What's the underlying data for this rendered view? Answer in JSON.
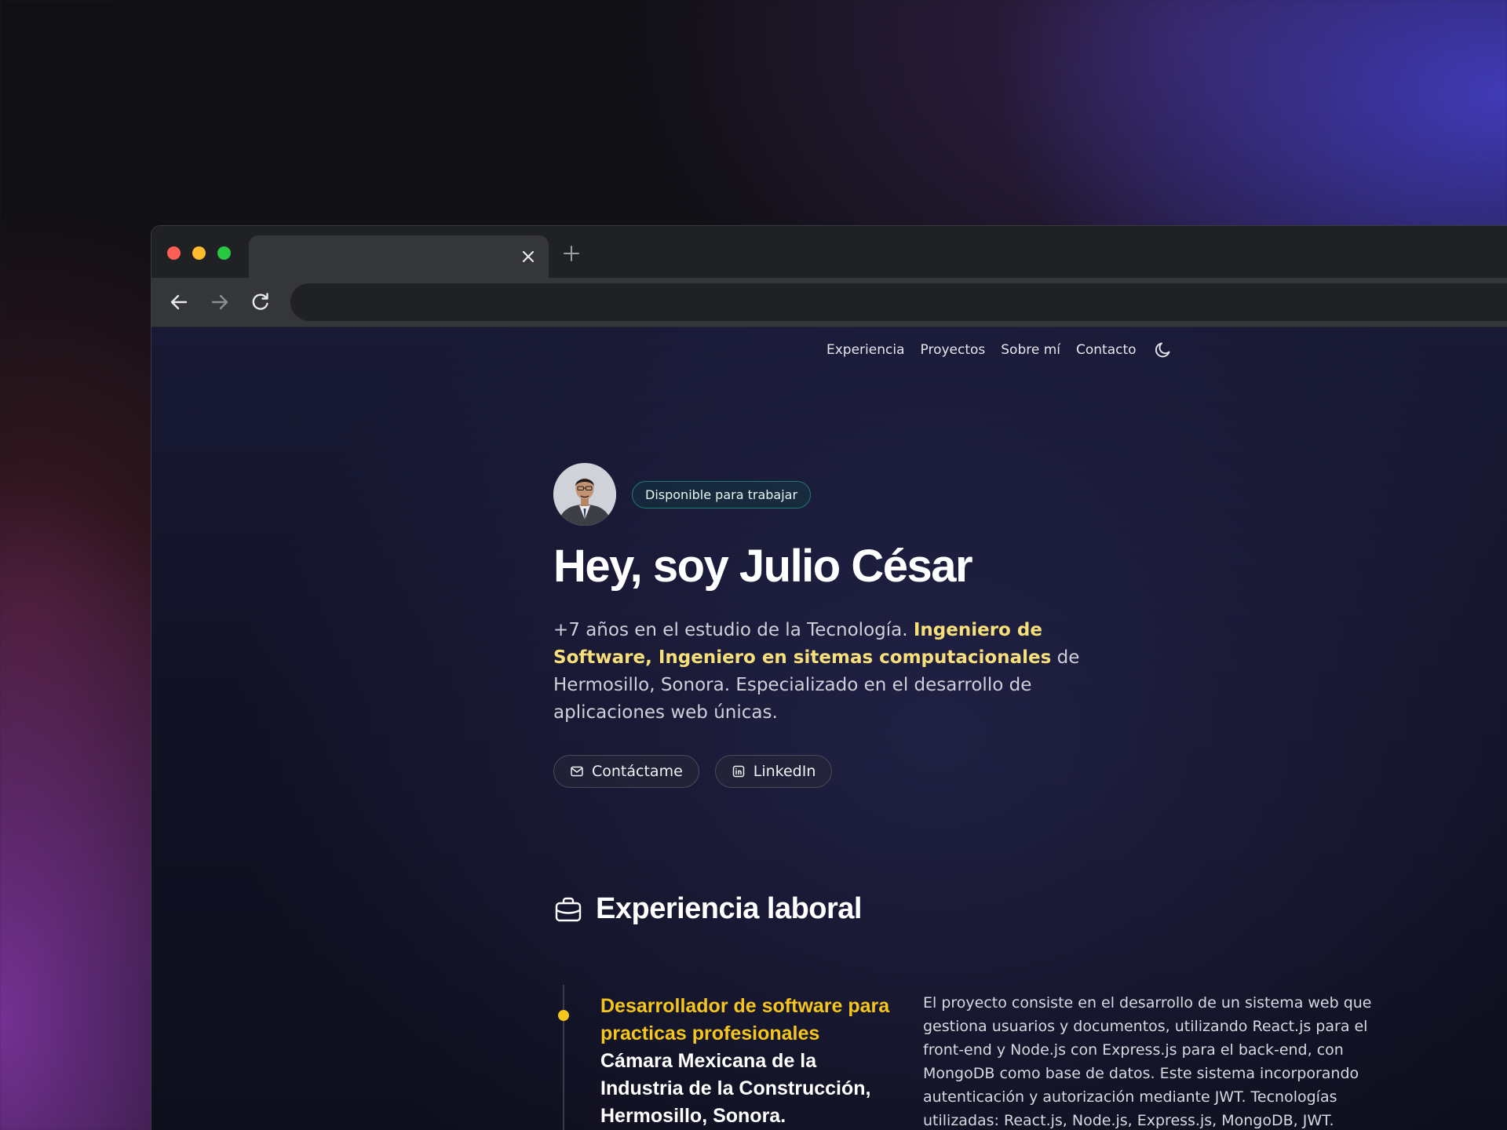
{
  "nav": {
    "links": [
      "Experiencia",
      "Proyectos",
      "Sobre mí",
      "Contacto"
    ],
    "theme_toggle_icon": "moon-icon"
  },
  "hero": {
    "badge": "Disponible para trabajar",
    "title": "Hey, soy Julio César",
    "desc_part1": "+7 años en el estudio de la Tecnología. ",
    "desc_highlight": "Ingeniero de Software, Ingeniero en sitemas computacionales",
    "desc_part2": " de Hermosillo, Sonora. Especializado en el desarrollo de aplicaciones web únicas.",
    "contact_button": "Contáctame",
    "linkedin_button": "LinkedIn"
  },
  "experience": {
    "title": "Experiencia laboral",
    "jobs": [
      {
        "role": "Desarrollador de software para practicas profesionales",
        "company": "Cámara Mexicana de la Industria de la Construcción, Hermosillo, Sonora.",
        "description": "El proyecto consiste en el desarrollo de un sistema web que gestiona usuarios y documentos, utilizando React.js para el front-end y Node.js con Express.js para el back-end, con MongoDB como base de datos. Este sistema incorporando autenticación y autorización mediante JWT. Tecnologías utilizadas: React.js, Node.js, Express.js, MongoDB, JWT."
      }
    ]
  },
  "colors": {
    "accent_yellow": "#f6c61c",
    "highlight_yellow": "#f7e07a",
    "badge_border": "#1f7a72",
    "traffic_red": "#ff5f57",
    "traffic_yellow": "#febc2e",
    "traffic_green": "#28c840"
  }
}
